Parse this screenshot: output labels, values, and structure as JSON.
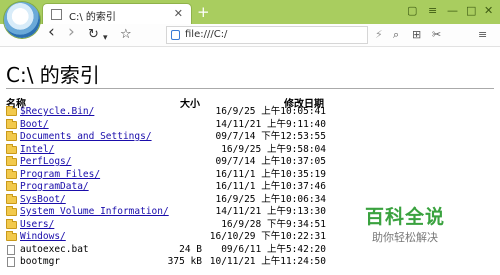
{
  "browser": {
    "tab_title": "C:\\ 的索引",
    "tab_close": "✕",
    "new_tab": "+",
    "window_controls": {
      "pin": "▢",
      "menu": "≡",
      "minimize": "—",
      "maximize": "□",
      "close": "✕"
    },
    "toolbar_icons": {
      "back": "‹",
      "forward": "›",
      "reload": "↻",
      "reload_menu": "▾",
      "bookmark": "☆",
      "flash": "⚡",
      "zoom": "⌕",
      "grid": "⊞",
      "tools": "✂",
      "more": "≡"
    },
    "address": "file:///C:/",
    "accent_color": "#a9cd5f"
  },
  "page": {
    "title": "C:\\ 的索引",
    "headers": {
      "name": "名称",
      "size": "大小",
      "modified": "修改日期"
    },
    "rows": [
      {
        "type": "folder",
        "name": "$Recycle.Bin/",
        "size": "",
        "date": "16/9/25 上午10:05:41"
      },
      {
        "type": "folder",
        "name": "Boot/",
        "size": "",
        "date": "14/11/21 上午9:11:40"
      },
      {
        "type": "folder",
        "name": "Documents and Settings/",
        "size": "",
        "date": "09/7/14 下午12:53:55"
      },
      {
        "type": "folder",
        "name": "Intel/",
        "size": "",
        "date": "16/9/25 上午9:58:04"
      },
      {
        "type": "folder",
        "name": "PerfLogs/",
        "size": "",
        "date": "09/7/14 上午10:37:05"
      },
      {
        "type": "folder",
        "name": "Program Files/",
        "size": "",
        "date": "16/11/1 上午10:35:19"
      },
      {
        "type": "folder",
        "name": "ProgramData/",
        "size": "",
        "date": "16/11/1 上午10:37:46"
      },
      {
        "type": "folder",
        "name": "SysBoot/",
        "size": "",
        "date": "16/9/25 上午10:06:34"
      },
      {
        "type": "folder",
        "name": "System Volume Information/",
        "size": "",
        "date": "14/11/21 上午9:13:30"
      },
      {
        "type": "folder",
        "name": "Users/",
        "size": "",
        "date": "16/9/28 下午9:34:51"
      },
      {
        "type": "folder",
        "name": "Windows/",
        "size": "",
        "date": "16/10/29 下午10:22:31"
      },
      {
        "type": "file",
        "name": "autoexec.bat",
        "size": "24 B",
        "date": "09/6/11 上午5:42:20"
      },
      {
        "type": "file",
        "name": "bootmgr",
        "size": "375 kB",
        "date": "10/11/21 上午11:24:50"
      }
    ]
  },
  "watermark": {
    "title": "百科全说",
    "subtitle": "助你轻松解决"
  }
}
